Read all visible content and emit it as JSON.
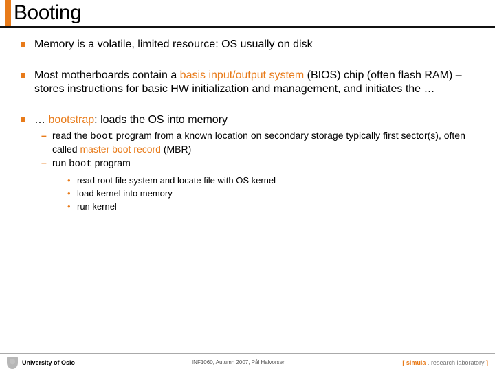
{
  "title": "Booting",
  "bullets": [
    {
      "text": "Memory is a volatile, limited resource: OS usually on disk"
    },
    {
      "parts": [
        {
          "t": "Most motherboards contain a "
        },
        {
          "t": "basis input/output system",
          "hl": true
        },
        {
          "t": " (BIOS) chip (often flash RAM) – stores instructions for basic HW initialization and management, and initiates the …"
        }
      ]
    },
    {
      "parts": [
        {
          "t": "… "
        },
        {
          "t": "bootstrap",
          "hl": true
        },
        {
          "t": ": loads the OS into memory"
        }
      ],
      "subs": [
        {
          "parts": [
            {
              "t": "read the "
            },
            {
              "t": "boot",
              "mono": true
            },
            {
              "t": " program from a known location on secondary storage typically first sector(s), often called "
            },
            {
              "t": "master boot record",
              "hl": true
            },
            {
              "t": " (MBR)"
            }
          ]
        },
        {
          "parts": [
            {
              "t": "run "
            },
            {
              "t": "boot",
              "mono": true
            },
            {
              "t": " program"
            }
          ],
          "subs": [
            {
              "t": "read root file system and locate file with OS kernel"
            },
            {
              "t": "load kernel into memory"
            },
            {
              "t": "run kernel"
            }
          ]
        }
      ]
    }
  ],
  "footer": {
    "left": "University of Oslo",
    "center": "INF1060, Autumn 2007, Pål Halvorsen",
    "right_bracket_l": "[ ",
    "right_simula": "simula",
    "right_dot": " . ",
    "right_lab": "research laboratory",
    "right_bracket_r": " ]"
  }
}
